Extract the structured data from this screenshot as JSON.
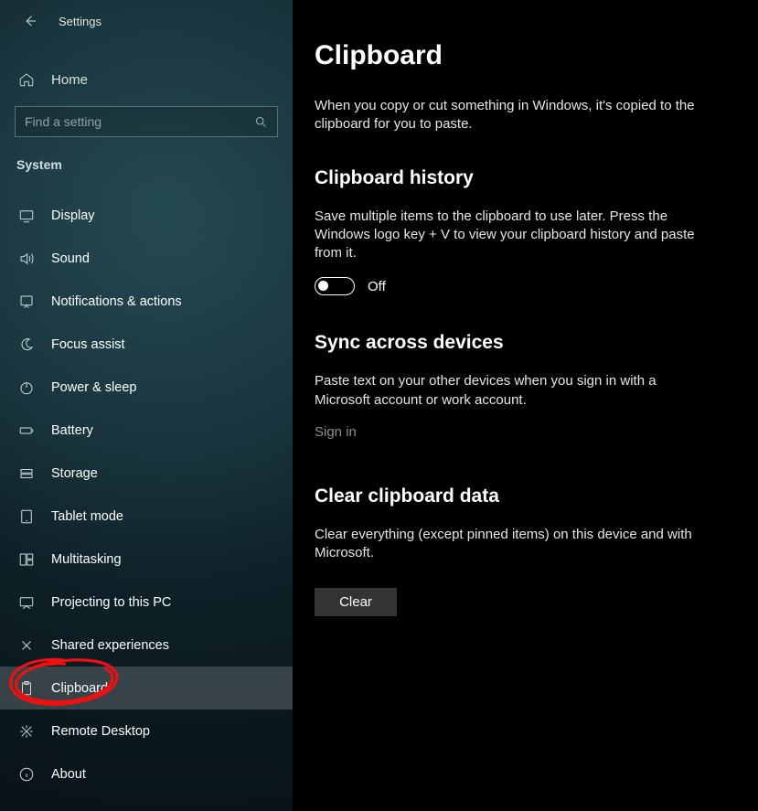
{
  "sidebar": {
    "app_title": "Settings",
    "home_label": "Home",
    "search_placeholder": "Find a setting",
    "group_header": "System",
    "items": [
      {
        "label": "Display"
      },
      {
        "label": "Sound"
      },
      {
        "label": "Notifications & actions"
      },
      {
        "label": "Focus assist"
      },
      {
        "label": "Power & sleep"
      },
      {
        "label": "Battery"
      },
      {
        "label": "Storage"
      },
      {
        "label": "Tablet mode"
      },
      {
        "label": "Multitasking"
      },
      {
        "label": "Projecting to this PC"
      },
      {
        "label": "Shared experiences"
      },
      {
        "label": "Clipboard"
      },
      {
        "label": "Remote Desktop"
      },
      {
        "label": "About"
      }
    ]
  },
  "main": {
    "title": "Clipboard",
    "intro": "When you copy or cut something in Windows, it's copied to the clipboard for you to paste.",
    "history": {
      "heading": "Clipboard history",
      "desc": "Save multiple items to the clipboard to use later. Press the Windows logo key + V to view your clipboard history and paste from it.",
      "toggle_state": "Off"
    },
    "sync": {
      "heading": "Sync across devices",
      "desc": "Paste text on your other devices when you sign in with a Microsoft account or work account.",
      "signin_label": "Sign in"
    },
    "clear": {
      "heading": "Clear clipboard data",
      "desc": "Clear everything (except pinned items) on this device and with Microsoft.",
      "button_label": "Clear"
    }
  }
}
